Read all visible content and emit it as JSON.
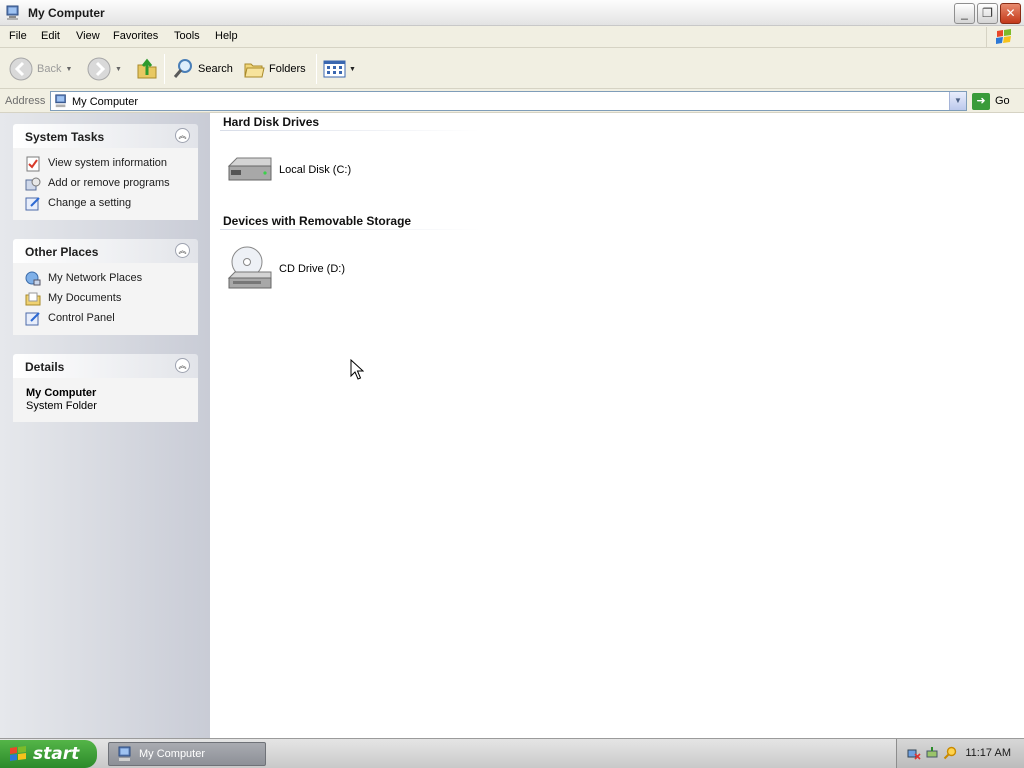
{
  "window": {
    "title": "My Computer"
  },
  "menu": {
    "items": [
      "File",
      "Edit",
      "View",
      "Favorites",
      "Tools",
      "Help"
    ]
  },
  "toolbar": {
    "back_label": "Back",
    "search_label": "Search",
    "folders_label": "Folders"
  },
  "address": {
    "label": "Address",
    "value": "My Computer",
    "go_label": "Go"
  },
  "sidebar": {
    "system_tasks": {
      "title": "System Tasks",
      "items": [
        "View system information",
        "Add or remove programs",
        "Change a setting"
      ]
    },
    "other_places": {
      "title": "Other Places",
      "items": [
        "My Network Places",
        "My Documents",
        "Control Panel"
      ]
    },
    "details": {
      "title": "Details",
      "name": "My Computer",
      "type": "System Folder"
    }
  },
  "content": {
    "groups": [
      {
        "title": "Hard Disk Drives",
        "items": [
          "Local Disk (C:)"
        ]
      },
      {
        "title": "Devices with Removable Storage",
        "items": [
          "CD Drive (D:)"
        ]
      }
    ]
  },
  "taskbar": {
    "start_label": "start",
    "open_window": "My Computer",
    "clock": "11:17 AM"
  },
  "colors": {
    "sidebar_bg": "#c9ccd6",
    "start_green": "#3a9b3a",
    "window_bg": "#f1efe2"
  }
}
